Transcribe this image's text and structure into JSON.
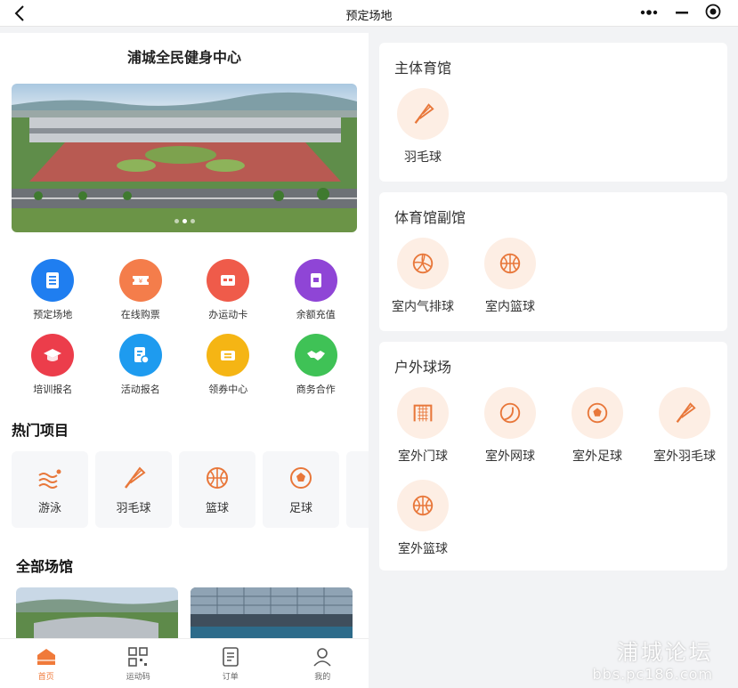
{
  "topbar": {
    "title": "预定场地",
    "back_icon": "chevron-left-icon",
    "more_icon": "more-dots-icon",
    "minimize_icon": "minus-icon",
    "close_icon": "target-circle-icon"
  },
  "center_name": "浦城全民健身中心",
  "grid": [
    {
      "label": "预定场地",
      "color": "#1f7ef0",
      "icon": "list-icon"
    },
    {
      "label": "在线购票",
      "color": "#f47d4b",
      "icon": "ticket-icon"
    },
    {
      "label": "办运动卡",
      "color": "#ef5b4a",
      "icon": "card-icon"
    },
    {
      "label": "余额充值",
      "color": "#8f45d6",
      "icon": "wallet-icon"
    },
    {
      "label": "培训报名",
      "color": "#ec3d4b",
      "icon": "graduation-cap-icon"
    },
    {
      "label": "活动报名",
      "color": "#1e9bef",
      "icon": "document-icon"
    },
    {
      "label": "领券中心",
      "color": "#f5b514",
      "icon": "coupon-icon"
    },
    {
      "label": "商务合作",
      "color": "#3fc256",
      "icon": "handshake-icon"
    }
  ],
  "hot": {
    "title": "热门项目",
    "items": [
      {
        "label": "游泳"
      },
      {
        "label": "羽毛球"
      },
      {
        "label": "篮球"
      },
      {
        "label": "足球"
      }
    ]
  },
  "venues": {
    "title": "全部场馆"
  },
  "tabs": [
    {
      "label": "首页"
    },
    {
      "label": "运动码"
    },
    {
      "label": "订单"
    },
    {
      "label": "我的"
    }
  ],
  "cards": [
    {
      "title": "主体育馆",
      "sports": [
        {
          "label": "羽毛球"
        }
      ]
    },
    {
      "title": "体育馆副馆",
      "sports": [
        {
          "label": "室内气排球"
        },
        {
          "label": "室内篮球"
        }
      ]
    },
    {
      "title": "户外球场",
      "sports": [
        {
          "label": "室外门球"
        },
        {
          "label": "室外网球"
        },
        {
          "label": "室外足球"
        },
        {
          "label": "室外羽毛球"
        },
        {
          "label": "室外篮球"
        }
      ]
    }
  ],
  "accent": "#e8773a",
  "watermark": {
    "line1": "浦城论坛",
    "line2": "bbs.pc186.com"
  }
}
